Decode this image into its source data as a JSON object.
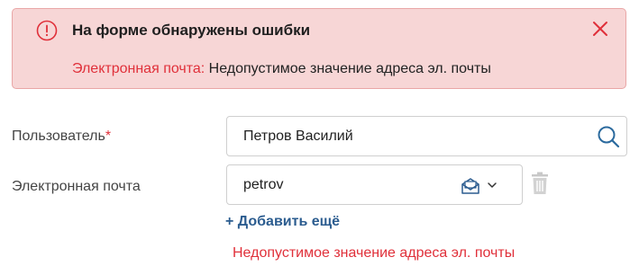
{
  "alert": {
    "title": "На форме обнаружены ошибки",
    "field_name": "Электронная почта:",
    "message": " Недопустимое значение адреса эл. почты",
    "icons": {
      "status": "exclamation-circle-icon",
      "close": "close-icon"
    }
  },
  "form": {
    "user": {
      "label": "Пользователь",
      "required_mark": "*",
      "value": "Петров Василий",
      "icon": "search-icon"
    },
    "email": {
      "label": "Электронная почта",
      "value": "petrov",
      "icons": [
        "mail-icon",
        "chevron-down-icon",
        "trash-icon"
      ],
      "add_more": "+ Добавить ещё",
      "error": "Недопустимое значение адреса эл. почты"
    }
  },
  "colors": {
    "error": "#e0303a",
    "alert_bg": "#f7d6d6",
    "link": "#2b5c8f"
  }
}
